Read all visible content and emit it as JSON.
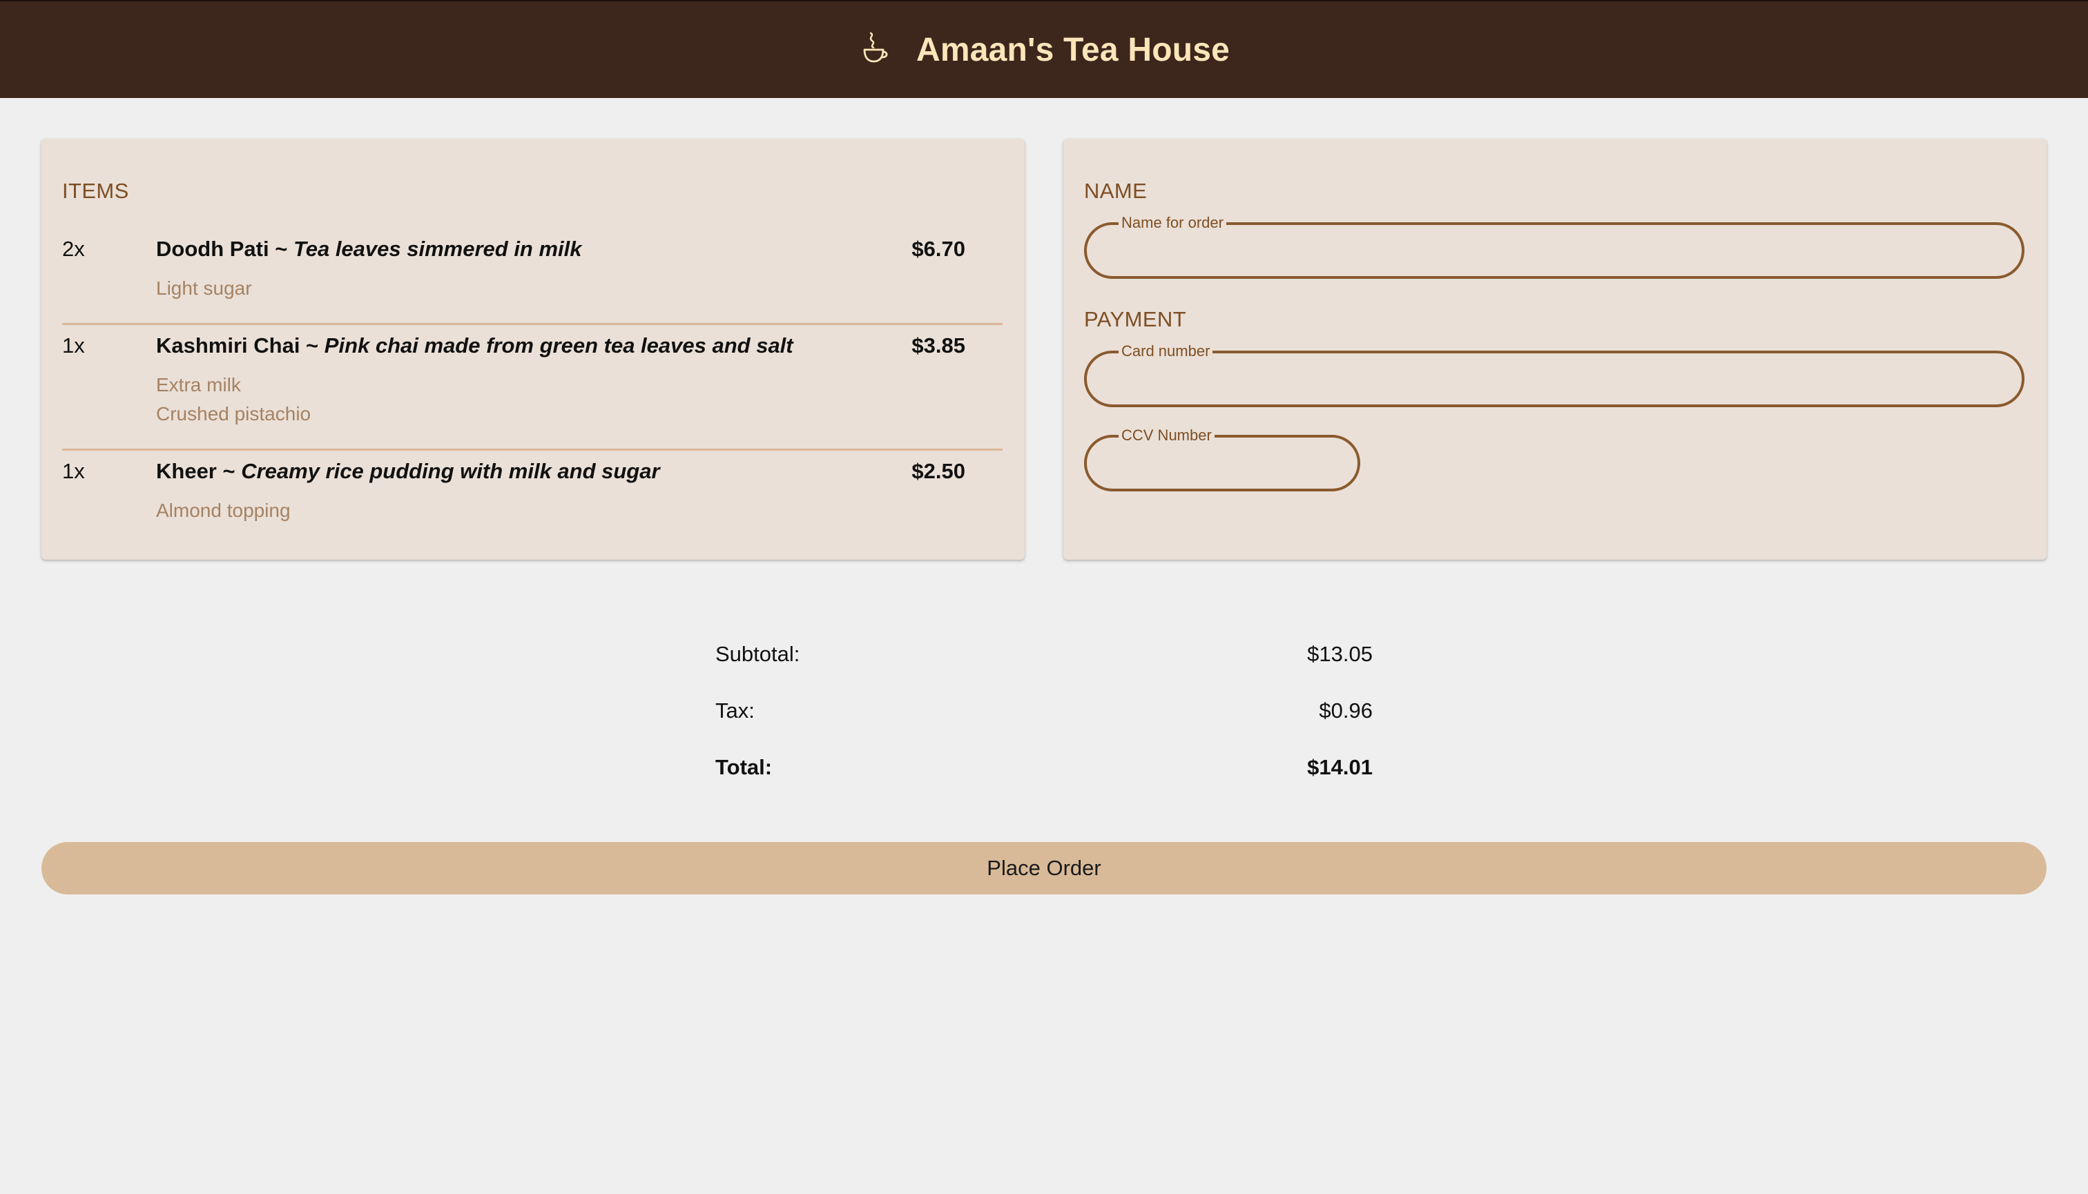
{
  "header": {
    "title": "Amaan's Tea House",
    "icon": "tea-cup-icon"
  },
  "items_section": {
    "heading": "ITEMS",
    "items": [
      {
        "qty": "2x",
        "name": "Doodh Pati ~ ",
        "description": "Tea leaves simmered in milk",
        "price": "$6.70",
        "options": [
          "Light sugar"
        ]
      },
      {
        "qty": "1x",
        "name": "Kashmiri Chai ~ ",
        "description": "Pink chai made from green tea leaves and salt",
        "price": "$3.85",
        "options": [
          "Extra milk",
          "Crushed pistachio"
        ]
      },
      {
        "qty": "1x",
        "name": "Kheer ~ ",
        "description": "Creamy rice pudding with milk and sugar",
        "price": "$2.50",
        "options": [
          "Almond topping"
        ]
      }
    ]
  },
  "name_section": {
    "heading": "NAME",
    "name_field": {
      "label": "Name for order",
      "value": ""
    }
  },
  "payment_section": {
    "heading": "PAYMENT",
    "card_field": {
      "label": "Card number",
      "value": ""
    },
    "ccv_field": {
      "label": "CCV Number",
      "value": ""
    }
  },
  "totals": {
    "subtotal_label": "Subtotal:",
    "subtotal_value": "$13.05",
    "tax_label": "Tax:",
    "tax_value": "$0.96",
    "total_label": "Total:",
    "total_value": "$14.01"
  },
  "actions": {
    "place_order_label": "Place Order"
  },
  "colors": {
    "header_bg": "#3d261c",
    "header_text": "#fbe5b9",
    "card_bg": "#eae0d7",
    "accent": "#7d4e24",
    "button_bg": "#d9ba98"
  }
}
